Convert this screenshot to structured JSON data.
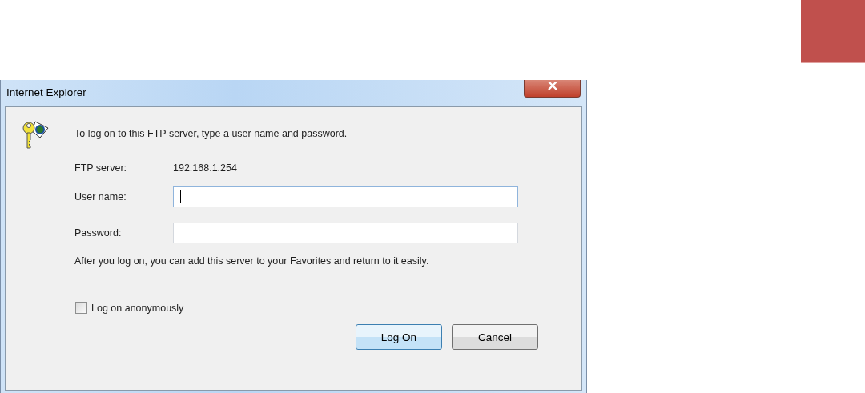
{
  "window": {
    "title": "Internet Explorer"
  },
  "message": "To log on to this FTP server, type a user name and password.",
  "server": {
    "label": "FTP server:",
    "value": "192.168.1.254"
  },
  "fields": [
    {
      "label": "User name:",
      "focused": true
    },
    {
      "label": "Password:",
      "focused": false
    }
  ],
  "note": "After you log on, you can add this server to your Favorites and return to it easily.",
  "anonymous": {
    "label": "Log on anonymously",
    "checked": false
  },
  "buttons": [
    {
      "label": "Log On",
      "default": true
    },
    {
      "label": "Cancel",
      "default": false
    }
  ]
}
